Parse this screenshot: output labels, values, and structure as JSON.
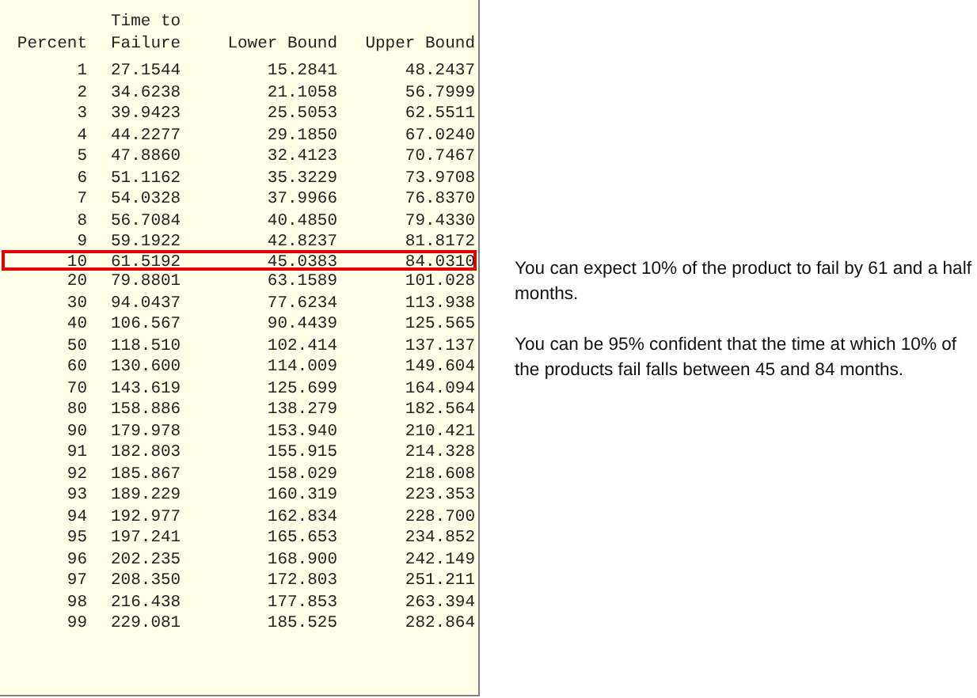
{
  "table": {
    "columns": [
      "Percent",
      "Time to Failure",
      "Lower Bound",
      "Upper Bound"
    ],
    "rows": [
      {
        "cells": [
          "1",
          "27.1544",
          "15.2841",
          "48.2437"
        ],
        "selected": false
      },
      {
        "cells": [
          "2",
          "34.6238",
          "21.1058",
          "56.7999"
        ],
        "selected": false
      },
      {
        "cells": [
          "3",
          "39.9423",
          "25.5053",
          "62.5511"
        ],
        "selected": false
      },
      {
        "cells": [
          "4",
          "44.2277",
          "29.1850",
          "67.0240"
        ],
        "selected": false
      },
      {
        "cells": [
          "5",
          "47.8860",
          "32.4123",
          "70.7467"
        ],
        "selected": false
      },
      {
        "cells": [
          "6",
          "51.1162",
          "35.3229",
          "73.9708"
        ],
        "selected": false
      },
      {
        "cells": [
          "7",
          "54.0328",
          "37.9966",
          "76.8370"
        ],
        "selected": false
      },
      {
        "cells": [
          "8",
          "56.7084",
          "40.4850",
          "79.4330"
        ],
        "selected": false
      },
      {
        "cells": [
          "9",
          "59.1922",
          "42.8237",
          "81.8172"
        ],
        "selected": false
      },
      {
        "cells": [
          "10",
          "61.5192",
          "45.0383",
          "84.0310"
        ],
        "selected": true
      },
      {
        "cells": [
          "20",
          "79.8801",
          "63.1589",
          "101.028"
        ],
        "selected": false
      },
      {
        "cells": [
          "30",
          "94.0437",
          "77.6234",
          "113.938"
        ],
        "selected": false
      },
      {
        "cells": [
          "40",
          "106.567",
          "90.4439",
          "125.565"
        ],
        "selected": false
      },
      {
        "cells": [
          "50",
          "118.510",
          "102.414",
          "137.137"
        ],
        "selected": false
      },
      {
        "cells": [
          "60",
          "130.600",
          "114.009",
          "149.604"
        ],
        "selected": false
      },
      {
        "cells": [
          "70",
          "143.619",
          "125.699",
          "164.094"
        ],
        "selected": false
      },
      {
        "cells": [
          "80",
          "158.886",
          "138.279",
          "182.564"
        ],
        "selected": false
      },
      {
        "cells": [
          "90",
          "179.978",
          "153.940",
          "210.421"
        ],
        "selected": false
      },
      {
        "cells": [
          "91",
          "182.803",
          "155.915",
          "214.328"
        ],
        "selected": false
      },
      {
        "cells": [
          "92",
          "185.867",
          "158.029",
          "218.608"
        ],
        "selected": false
      },
      {
        "cells": [
          "93",
          "189.229",
          "160.319",
          "223.353"
        ],
        "selected": false
      },
      {
        "cells": [
          "94",
          "192.977",
          "162.834",
          "228.700"
        ],
        "selected": false
      },
      {
        "cells": [
          "95",
          "197.241",
          "165.653",
          "234.852"
        ],
        "selected": false
      },
      {
        "cells": [
          "96",
          "202.235",
          "168.900",
          "242.149"
        ],
        "selected": false
      },
      {
        "cells": [
          "97",
          "208.350",
          "172.803",
          "251.211"
        ],
        "selected": false
      },
      {
        "cells": [
          "98",
          "216.438",
          "177.853",
          "263.394"
        ],
        "selected": false
      },
      {
        "cells": [
          "99",
          "229.081",
          "185.525",
          "282.864"
        ],
        "selected": false
      }
    ]
  },
  "notes": [
    "You can expect 10% of the product to fail by 61 and a half months.",
    "You can be 95% confident that the time at which 10% of the products fail falls between 45 and 84 months."
  ]
}
